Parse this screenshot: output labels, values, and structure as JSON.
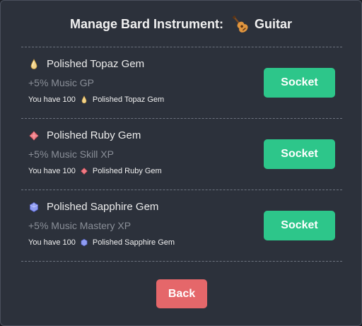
{
  "title": {
    "prefix": "Manage Bard Instrument:",
    "instrument_icon": "guitar-icon",
    "instrument_name": "Guitar"
  },
  "gems": [
    {
      "name": "Polished Topaz Gem",
      "icon": "topaz-gem-icon",
      "color": "#f2d38a",
      "effect": "+5% Music GP",
      "have_prefix": "You have 100",
      "have_name": "Polished Topaz Gem",
      "button_label": "Socket"
    },
    {
      "name": "Polished Ruby Gem",
      "icon": "ruby-gem-icon",
      "color": "#f07b84",
      "effect": "+5% Music Skill XP",
      "have_prefix": "You have 100",
      "have_name": "Polished Ruby Gem",
      "button_label": "Socket"
    },
    {
      "name": "Polished Sapphire Gem",
      "icon": "sapphire-gem-icon",
      "color": "#8f9cf2",
      "effect": "+5% Music Mastery XP",
      "have_prefix": "You have 100",
      "have_name": "Polished Sapphire Gem",
      "button_label": "Socket"
    }
  ],
  "back_label": "Back",
  "colors": {
    "socket_button": "#2dc68a",
    "back_button": "#e5676a",
    "modal_background": "#2c313b"
  }
}
